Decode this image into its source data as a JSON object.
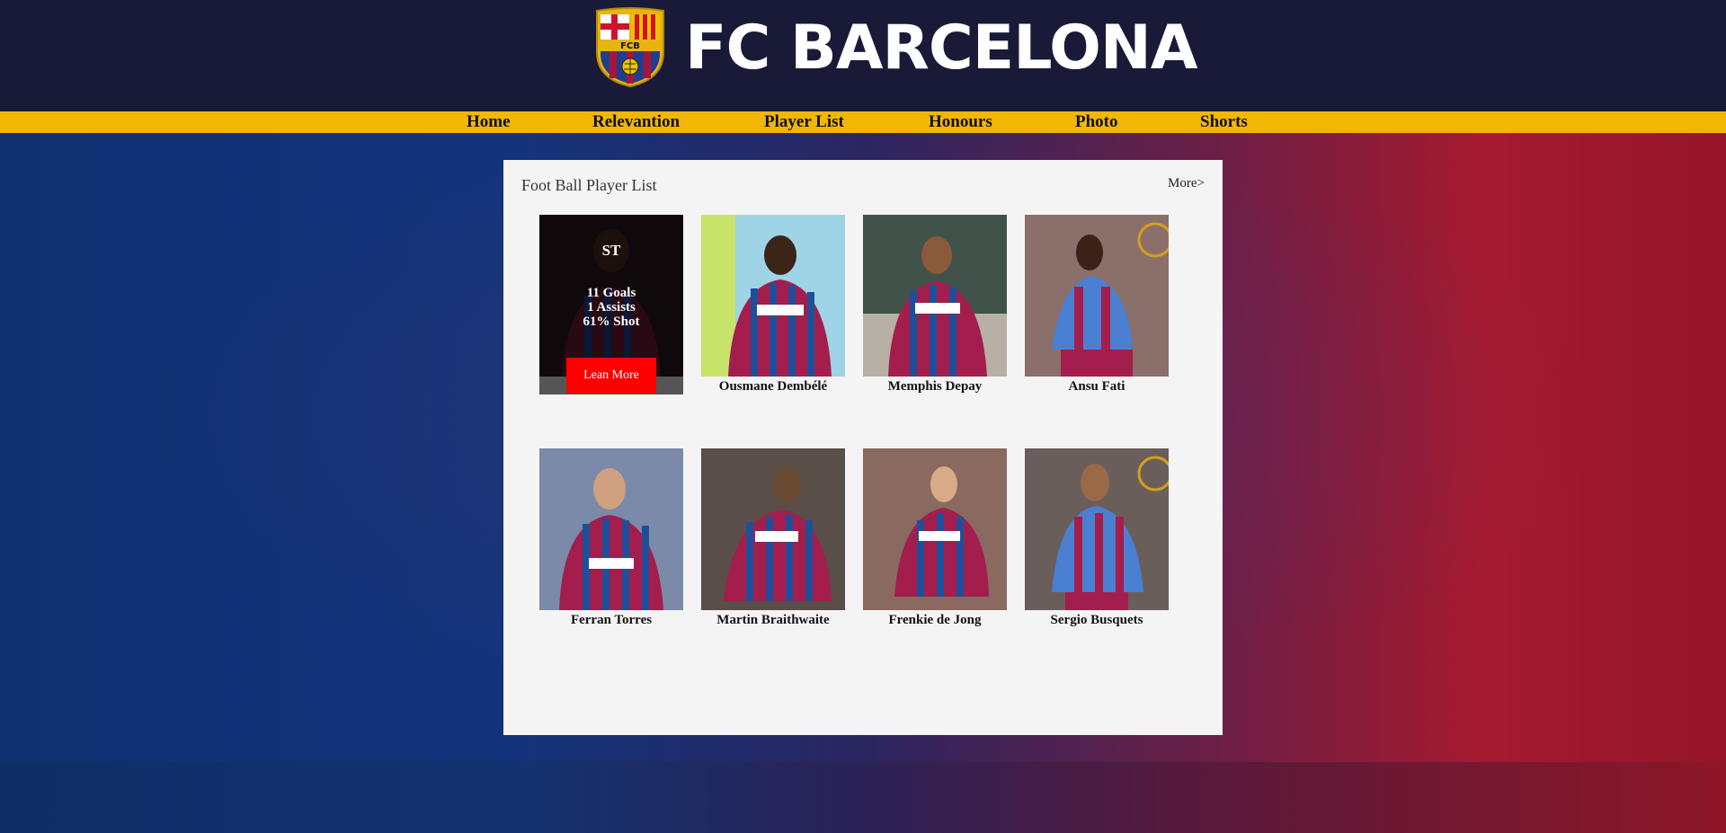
{
  "header": {
    "brand": "FC BARCELONA",
    "crest_letters": "FCB"
  },
  "nav": {
    "items": [
      {
        "label": "Home"
      },
      {
        "label": "Relevantion"
      },
      {
        "label": "Player List"
      },
      {
        "label": "Honours"
      },
      {
        "label": "Photo"
      },
      {
        "label": "Shorts"
      }
    ]
  },
  "panel": {
    "title": "Foot Ball Player List",
    "more": "More>"
  },
  "featured": {
    "position": "ST",
    "goals": "11 Goals",
    "assists": "1 Assists",
    "shot": "61% Shot",
    "button": "Lean More"
  },
  "players": [
    {
      "name": ""
    },
    {
      "name": "Ousmane Dembélé"
    },
    {
      "name": "Memphis Depay"
    },
    {
      "name": "Ansu Fati"
    },
    {
      "name": "Ferran Torres"
    },
    {
      "name": "Martin Braithwaite"
    },
    {
      "name": "Frenkie de Jong"
    },
    {
      "name": "Sergio Busquets"
    }
  ],
  "colors": {
    "header_bg": "#181a37",
    "nav_bg": "#f2b705",
    "panel_bg": "#f4f4f4",
    "button_red": "#ff0000",
    "blaugrana_blue": "#1f4f9b",
    "blaugrana_red": "#a7153a"
  },
  "icons": {
    "crest": "fc-barcelona-crest-icon"
  }
}
